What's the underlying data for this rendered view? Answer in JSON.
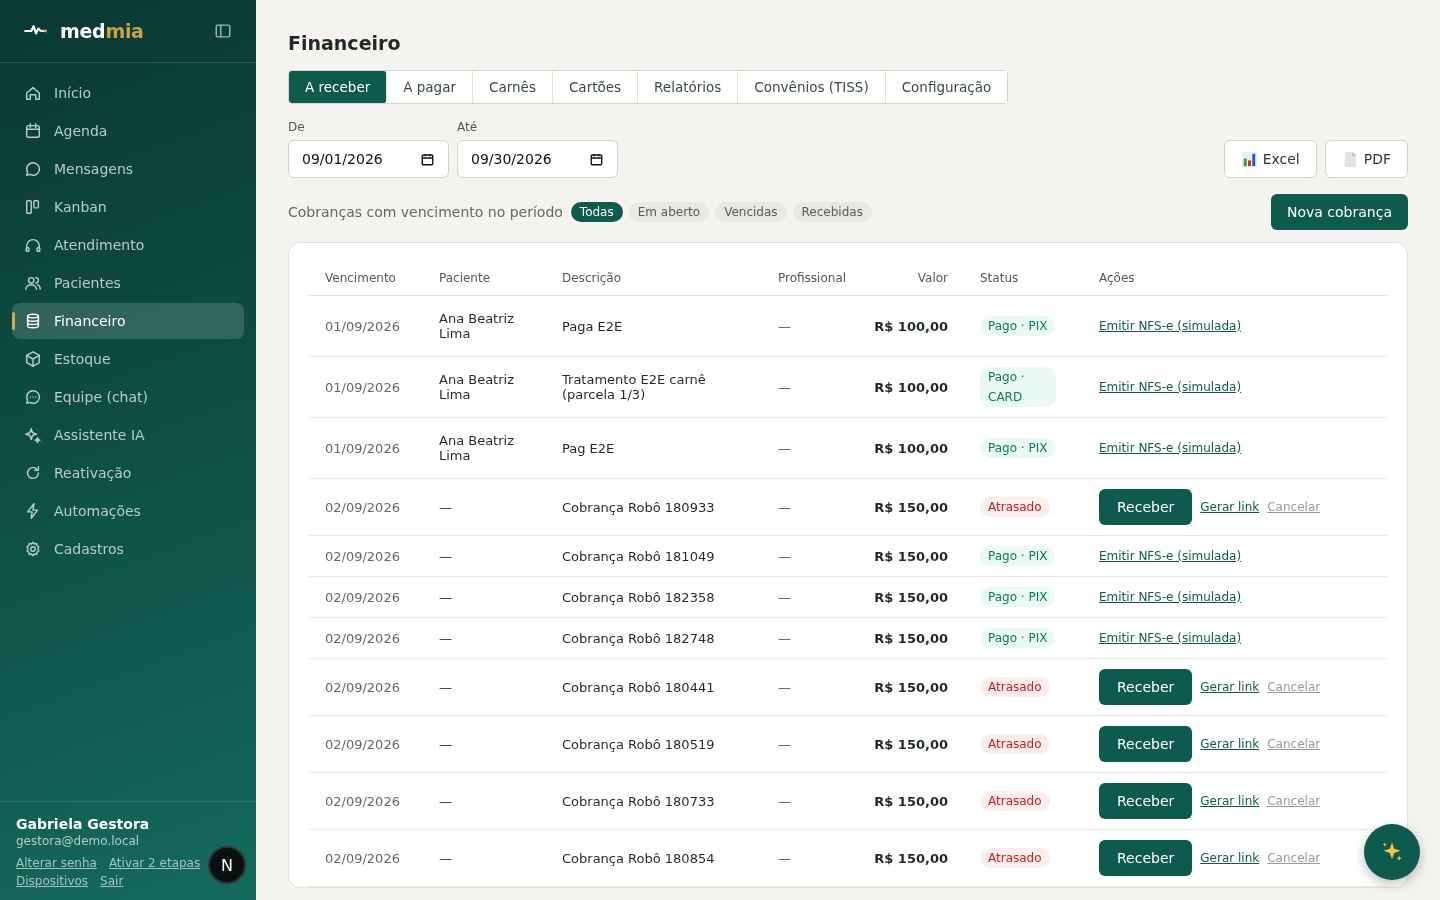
{
  "brand": {
    "part_1": "med",
    "part_2": "mia"
  },
  "sidebar": {
    "items": [
      {
        "label": "Início",
        "selected": false
      },
      {
        "label": "Agenda",
        "selected": false
      },
      {
        "label": "Mensagens",
        "selected": false
      },
      {
        "label": "Kanban",
        "selected": false
      },
      {
        "label": "Atendimento",
        "selected": false
      },
      {
        "label": "Pacientes",
        "selected": false
      },
      {
        "label": "Financeiro",
        "selected": true
      },
      {
        "label": "Estoque",
        "selected": false
      },
      {
        "label": "Equipe (chat)",
        "selected": false
      },
      {
        "label": "Assistente IA",
        "selected": false
      },
      {
        "label": "Reativação",
        "selected": false
      },
      {
        "label": "Automações",
        "selected": false
      },
      {
        "label": "Cadastros",
        "selected": false
      }
    ],
    "user": {
      "name": "Gabriela Gestora",
      "email": "gestora@demo.local",
      "links": [
        "Alterar senha",
        "Ativar 2 etapas",
        "Dispositivos",
        "Sair"
      ]
    }
  },
  "page_title": "Financeiro",
  "tabs": [
    {
      "label": "A receber",
      "selected": true
    },
    {
      "label": "A pagar",
      "selected": false
    },
    {
      "label": "Carnês",
      "selected": false
    },
    {
      "label": "Cartões",
      "selected": false
    },
    {
      "label": "Relatórios",
      "selected": false
    },
    {
      "label": "Convênios (TISS)",
      "selected": false
    },
    {
      "label": "Configuração",
      "selected": false
    }
  ],
  "date_from": {
    "label": "De",
    "value": "09/01/2026"
  },
  "date_to": {
    "label": "Até",
    "value": "09/30/2026"
  },
  "export_buttons": [
    "Excel",
    "PDF"
  ],
  "filter_caption": "Cobranças com vencimento no período",
  "filters": [
    {
      "label": "Todas",
      "selected": true
    },
    {
      "label": "Em aberto",
      "selected": false
    },
    {
      "label": "Vencidas",
      "selected": false
    },
    {
      "label": "Recebidas",
      "selected": false
    }
  ],
  "new_button": "Nova cobrança",
  "table": {
    "columns": [
      "Vencimento",
      "Paciente",
      "Descrição",
      "Profissional",
      "Valor",
      "Status",
      "Ações"
    ],
    "rows": [
      {
        "due": "01/09/2026",
        "patient": "Ana Beatriz Lima",
        "description": "Paga E2E",
        "professional": "—",
        "value": "R$ 100,00",
        "status": {
          "label": "Pago · PIX",
          "kind": "paid"
        },
        "actions": {
          "kind": "invoice",
          "link": "Emitir NFS-e (simulada)"
        }
      },
      {
        "due": "01/09/2026",
        "patient": "Ana Beatriz Lima",
        "description": "Tratamento E2E carnê (parcela 1/3)",
        "professional": "—",
        "value": "R$ 100,00",
        "status": {
          "label": "Pago · CARD",
          "kind": "paid"
        },
        "actions": {
          "kind": "invoice",
          "link": "Emitir NFS-e (simulada)"
        }
      },
      {
        "due": "01/09/2026",
        "patient": "Ana Beatriz Lima",
        "description": "Pag E2E",
        "professional": "—",
        "value": "R$ 100,00",
        "status": {
          "label": "Pago · PIX",
          "kind": "paid"
        },
        "actions": {
          "kind": "invoice",
          "link": "Emitir NFS-e (simulada)"
        }
      },
      {
        "due": "02/09/2026",
        "patient": "—",
        "description": "Cobrança Robô 180933",
        "professional": "—",
        "value": "R$ 150,00",
        "status": {
          "label": "Atrasado",
          "kind": "overdue"
        },
        "actions": {
          "kind": "collect",
          "button": "Receber",
          "link": "Gerar link",
          "cancel": "Cancelar"
        }
      },
      {
        "due": "02/09/2026",
        "patient": "—",
        "description": "Cobrança Robô 181049",
        "professional": "—",
        "value": "R$ 150,00",
        "status": {
          "label": "Pago · PIX",
          "kind": "paid"
        },
        "actions": {
          "kind": "invoice",
          "link": "Emitir NFS-e (simulada)"
        }
      },
      {
        "due": "02/09/2026",
        "patient": "—",
        "description": "Cobrança Robô 182358",
        "professional": "—",
        "value": "R$ 150,00",
        "status": {
          "label": "Pago · PIX",
          "kind": "paid"
        },
        "actions": {
          "kind": "invoice",
          "link": "Emitir NFS-e (simulada)"
        }
      },
      {
        "due": "02/09/2026",
        "patient": "—",
        "description": "Cobrança Robô 182748",
        "professional": "—",
        "value": "R$ 150,00",
        "status": {
          "label": "Pago · PIX",
          "kind": "paid"
        },
        "actions": {
          "kind": "invoice",
          "link": "Emitir NFS-e (simulada)"
        }
      },
      {
        "due": "02/09/2026",
        "patient": "—",
        "description": "Cobrança Robô 180441",
        "professional": "—",
        "value": "R$ 150,00",
        "status": {
          "label": "Atrasado",
          "kind": "overdue"
        },
        "actions": {
          "kind": "collect",
          "button": "Receber",
          "link": "Gerar link",
          "cancel": "Cancelar"
        }
      },
      {
        "due": "02/09/2026",
        "patient": "—",
        "description": "Cobrança Robô 180519",
        "professional": "—",
        "value": "R$ 150,00",
        "status": {
          "label": "Atrasado",
          "kind": "overdue"
        },
        "actions": {
          "kind": "collect",
          "button": "Receber",
          "link": "Gerar link",
          "cancel": "Cancelar"
        }
      },
      {
        "due": "02/09/2026",
        "patient": "—",
        "description": "Cobrança Robô 180733",
        "professional": "—",
        "value": "R$ 150,00",
        "status": {
          "label": "Atrasado",
          "kind": "overdue"
        },
        "actions": {
          "kind": "collect",
          "button": "Receber",
          "link": "Gerar link",
          "cancel": "Cancelar"
        }
      },
      {
        "due": "02/09/2026",
        "patient": "—",
        "description": "Cobrança Robô 180854",
        "professional": "—",
        "value": "R$ 150,00",
        "status": {
          "label": "Atrasado",
          "kind": "overdue"
        },
        "actions": {
          "kind": "collect",
          "button": "Receber",
          "link": "Gerar link",
          "cancel": "Cancelar"
        }
      }
    ]
  },
  "dev_badge": "N"
}
